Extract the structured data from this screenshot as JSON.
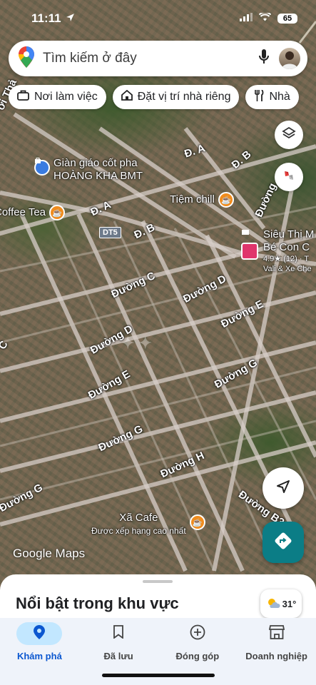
{
  "status_bar": {
    "time": "11:11",
    "battery": "65"
  },
  "search": {
    "placeholder": "Tìm kiếm ở đây"
  },
  "chips": [
    {
      "label": "Nơi làm việc",
      "icon": "briefcase-icon"
    },
    {
      "label": "Đặt vị trí nhà riêng",
      "icon": "home-icon"
    },
    {
      "label": "Nhà",
      "icon": "restaurant-icon"
    }
  ],
  "map": {
    "roads": [
      {
        "label": "Đ. A"
      },
      {
        "label": "Đ. B"
      },
      {
        "label": "Đ. A"
      },
      {
        "label": "Đ. B"
      },
      {
        "label": "Đường C"
      },
      {
        "label": "Đường D"
      },
      {
        "label": "Đường E"
      },
      {
        "label": "Đường D"
      },
      {
        "label": "Đường E"
      },
      {
        "label": "Đường G"
      },
      {
        "label": "Đường G"
      },
      {
        "label": "Đường H"
      },
      {
        "label": "Đường G"
      },
      {
        "label": "Đường B3"
      },
      {
        "label": "Đường"
      },
      {
        "label": "C"
      },
      {
        "label": "ời Thả"
      }
    ],
    "route_badge": "DT5",
    "pois": {
      "scaffold": {
        "line1": "Giàn giáo cốt pha",
        "line2": "HOÀNG KHA BMT"
      },
      "coffee_tea": "Coffee Tea",
      "tiem_chill": "Tiệm chill",
      "sieu_thi": {
        "line1": "Siêu Thị M",
        "line2": "Bé Con C",
        "rating": "4.9★ (12) · T",
        "line4": "Vali & Xe Che"
      },
      "xa_cafe": {
        "name": "Xã Cafe",
        "subtitle": "Được xếp hạng cao nhất"
      }
    },
    "brand": "Google Maps"
  },
  "sheet": {
    "title": "Nổi bật trong khu vực",
    "temperature": "31°"
  },
  "nav": [
    {
      "label": "Khám phá",
      "icon": "explore-pin-icon",
      "active": true
    },
    {
      "label": "Đã lưu",
      "icon": "bookmark-icon",
      "active": false
    },
    {
      "label": "Đóng góp",
      "icon": "add-circle-icon",
      "active": false
    },
    {
      "label": "Doanh nghiệp",
      "icon": "storefront-icon",
      "active": false
    }
  ],
  "colors": {
    "accent": "#0b57d0",
    "directions_fab": "#0b7d86",
    "nav_active_bg": "#c2e7ff"
  }
}
